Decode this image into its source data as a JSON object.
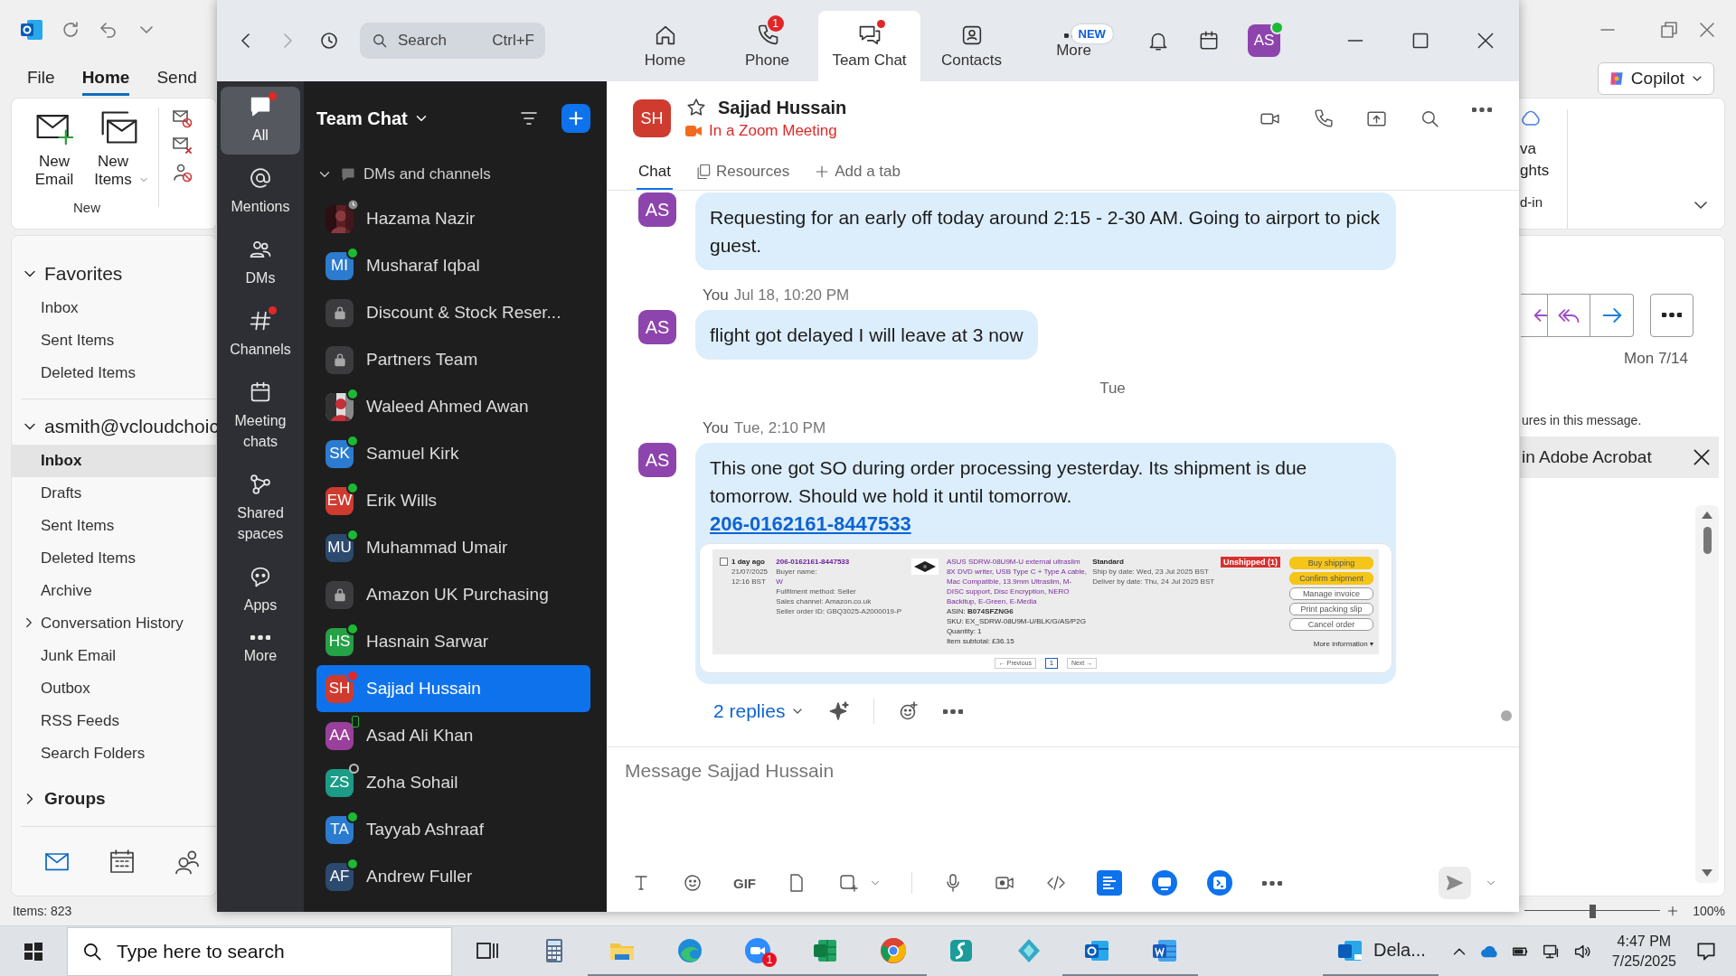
{
  "outlook": {
    "ribbon_tabs": [
      {
        "label": "File",
        "selected": false
      },
      {
        "label": "Home",
        "selected": true
      },
      {
        "label": "Send",
        "selected": false
      }
    ],
    "copilot": "Copilot",
    "ribbon": {
      "buttons": [
        {
          "label": "New Email",
          "dropdown": false
        },
        {
          "label": "New Items",
          "dropdown": true
        }
      ],
      "group_label": "New",
      "right_label": "va\nghts",
      "right_group_label": "d-in"
    },
    "favorites": {
      "label": "Favorites",
      "expanded": true,
      "folders": [
        {
          "label": "Inbox",
          "selected": false,
          "has_children": false
        },
        {
          "label": "Sent Items",
          "selected": false,
          "has_children": false
        },
        {
          "label": "Deleted Items",
          "selected": false,
          "has_children": false
        }
      ]
    },
    "account": {
      "label": "asmith@vcloudchoic",
      "expanded": true,
      "folders": [
        {
          "label": "Inbox",
          "selected": true,
          "has_children": false
        },
        {
          "label": "Drafts",
          "selected": false,
          "has_children": false
        },
        {
          "label": "Sent Items",
          "selected": false,
          "has_children": false
        },
        {
          "label": "Deleted Items",
          "selected": false,
          "has_children": false
        },
        {
          "label": "Archive",
          "selected": false,
          "has_children": false
        },
        {
          "label": "Conversation History",
          "selected": false,
          "has_children": true
        },
        {
          "label": "Junk Email",
          "selected": false,
          "has_children": false
        },
        {
          "label": "Outbox",
          "selected": false,
          "has_children": false
        },
        {
          "label": "RSS Feeds",
          "selected": false,
          "has_children": false
        },
        {
          "label": "Search Folders",
          "selected": false,
          "has_children": false
        }
      ]
    },
    "groups": {
      "label": "Groups",
      "expanded": false
    },
    "reading_pane": {
      "date": "Mon 7/14",
      "notice": "ures in this message.",
      "banner": "in Adobe Acrobat"
    },
    "status_bar": {
      "items": "Items: 823",
      "zoom": "100%",
      "zoom_slider": {
        "level": 0.5
      }
    }
  },
  "zoom": {
    "search": {
      "placeholder": "Search",
      "shortcut": "Ctrl+F"
    },
    "tabs": [
      {
        "label": "Home",
        "selected": false
      },
      {
        "label": "Phone",
        "selected": false,
        "badge": "1"
      },
      {
        "label": "Team Chat",
        "selected": true,
        "dot": true
      },
      {
        "label": "Contacts",
        "selected": false
      },
      {
        "label": "More",
        "selected": false,
        "tag": "NEW"
      }
    ],
    "profile": {
      "initials": "AS",
      "color": "#8e44ad",
      "online": true
    },
    "nav": [
      {
        "label": "All",
        "selected": true,
        "dot": true
      },
      {
        "label": "Mentions",
        "selected": false,
        "dot": false
      },
      {
        "label": "DMs",
        "selected": false,
        "dot": false
      },
      {
        "label": "Channels",
        "selected": false,
        "dot": true
      },
      {
        "label": "Meeting chats",
        "selected": false,
        "dot": false
      },
      {
        "label": "Shared spaces",
        "selected": false,
        "dot": false
      },
      {
        "label": "Apps",
        "selected": false,
        "dot": false
      },
      {
        "label": "More",
        "selected": false,
        "dot": false
      }
    ],
    "chat_list": {
      "title": "Team Chat",
      "section": {
        "label": "DMs and channels",
        "expanded": true
      },
      "items": [
        {
          "name": "Hazama Nazir",
          "status": {
            "kind": "clock"
          },
          "selected": false
        },
        {
          "name": "Musharaf Iqbal",
          "avatar": {
            "kind": "initials",
            "initials": "MI",
            "color": "#2b7bd0"
          },
          "status": {
            "kind": "available"
          },
          "selected": false
        },
        {
          "name": "Discount & Stock Reser...",
          "avatar": {
            "kind": "lock"
          },
          "selected": false
        },
        {
          "name": "Partners Team",
          "avatar": {
            "kind": "lock"
          },
          "selected": false
        },
        {
          "name": "Waleed Ahmed Awan",
          "status": {
            "kind": "available"
          },
          "selected": false
        },
        {
          "name": "Samuel Kirk",
          "avatar": {
            "kind": "initials",
            "initials": "SK",
            "color": "#2b7bd0"
          },
          "status": {
            "kind": "available"
          },
          "selected": false
        },
        {
          "name": "Erik Wills",
          "avatar": {
            "kind": "initials",
            "initials": "EW",
            "color": "#cf3b2f"
          },
          "status": {
            "kind": "available"
          },
          "selected": false
        },
        {
          "name": "Muhammad Umair",
          "avatar": {
            "kind": "initials",
            "initials": "MU",
            "color": "#2c4a6e"
          },
          "status": {
            "kind": "available"
          },
          "selected": false
        },
        {
          "name": "Amazon UK Purchasing",
          "avatar": {
            "kind": "lock"
          },
          "selected": false
        },
        {
          "name": "Hasnain Sarwar",
          "avatar": {
            "kind": "initials",
            "initials": "HS",
            "color": "#25a146"
          },
          "status": {
            "kind": "available"
          },
          "selected": false
        },
        {
          "name": "Sajjad Hussain",
          "avatar": {
            "kind": "initials",
            "initials": "SH",
            "color": "#cf3b2f"
          },
          "status": {
            "kind": "busy"
          },
          "selected": true
        },
        {
          "name": "Asad Ali Khan",
          "avatar": {
            "kind": "initials",
            "initials": "AA",
            "color": "#9a3f9b"
          },
          "status": {
            "kind": "mobile"
          },
          "selected": false
        },
        {
          "name": "Zoha Sohail",
          "avatar": {
            "kind": "initials",
            "initials": "ZS",
            "color": "#1c9b86"
          },
          "status": {
            "kind": "offline"
          },
          "selected": false
        },
        {
          "name": "Tayyab Ashraaf",
          "avatar": {
            "kind": "initials",
            "initials": "TA",
            "color": "#2b7bd0"
          },
          "status": {
            "kind": "available"
          },
          "selected": false
        },
        {
          "name": "Andrew Fuller",
          "avatar": {
            "kind": "initials",
            "initials": "AF",
            "color": "#2c4a6e"
          },
          "status": {
            "kind": "available"
          },
          "selected": false
        }
      ]
    },
    "conversation": {
      "name": "Sajjad Hussain",
      "avatar": {
        "initials": "SH",
        "color": "#cf3b2f"
      },
      "starred": false,
      "presence": "In a Zoom Meeting",
      "tabs": [
        {
          "label": "Chat",
          "selected": true
        },
        {
          "label": "Resources",
          "selected": false
        },
        {
          "label": "Add a tab",
          "selected": false
        }
      ],
      "messages": [
        {
          "kind": "message",
          "avatar": {
            "initials": "AS",
            "color": "#8e44ad"
          },
          "text": "Requesting for an early off today around 2:15 - 2-30 AM. Going to airport to pick guest."
        },
        {
          "kind": "message",
          "avatar": {
            "initials": "AS",
            "color": "#8e44ad"
          },
          "sender": "You",
          "time": "Jul 18, 10:20 PM",
          "text": "flight got delayed I will leave at 3 now"
        },
        {
          "kind": "date",
          "label": "Tue"
        },
        {
          "kind": "message",
          "avatar": {
            "initials": "AS",
            "color": "#8e44ad"
          },
          "sender": "You",
          "time": "Tue, 2:10 PM",
          "text": "This one got SO during order processing yesterday. Its shipment is due tomorrow. Should we hold it until tomorrow.",
          "link": "206-0162161-8447533",
          "attachment": {
            "kind": "screenshot",
            "checked": false,
            "date": [
              "1 day ago",
              "21/07/2025",
              "12:16 BST"
            ],
            "order_id": "206-0162161-8447533",
            "buyer_label": "Buyer name:",
            "buyer": "W",
            "order_details": [
              "Fulfilment method: Seller",
              "Sales channel: Amazon.co.uk",
              "Seller order ID: GBQ3025-A2000019-P"
            ],
            "product": "ASUS SDRW-08U9M-U external ultraslim 8X DVD writer, USB Type C + Type A cable, Mac Compatible, 13.9mm Ultraslim, M-DISC support, Disc Encryption, NERO Backitup, E-Green, E-Media",
            "product_details": [
              "ASIN: **B074SFZNG6**",
              "SKU: EX_SDRW-08U9M-U/BLK/G/AS/P2G",
              "Quantity: 1",
              "Item subtotal: £36.15"
            ],
            "order_type": "Standard",
            "dates": [
              "Ship by date: Wed, 23 Jul 2025 BST",
              "Deliver by date: Thu, 24 Jul 2025 BST"
            ],
            "status": "Unshipped (1)",
            "actions": [
              {
                "label": "Buy shipping",
                "primary": true
              },
              {
                "label": "Confirm shipment",
                "primary": true
              },
              {
                "label": "Manage invoice",
                "primary": false
              },
              {
                "label": "Print packing slip",
                "primary": false
              },
              {
                "label": "Cancel order",
                "primary": false
              }
            ],
            "more": "More information ▾",
            "pager": {
              "previous": "← Previous",
              "page": "1",
              "next": "Next →"
            }
          }
        }
      ],
      "replies": "2 replies"
    },
    "composer": {
      "placeholder": "Message Sajjad Hussain",
      "gif": "GIF"
    }
  },
  "taskbar": {
    "search_placeholder": "Type here to search",
    "apps": [
      {
        "running": false
      },
      {
        "running": false
      },
      {
        "running": true
      },
      {
        "running": true
      },
      {
        "running": true,
        "badge": "1"
      },
      {
        "running": true
      },
      {
        "running": true
      },
      {
        "running": false
      },
      {
        "running": false
      },
      {
        "running": true
      },
      {
        "running": true
      }
    ],
    "tray_app": "Dela...",
    "time": "4:47 PM",
    "date": "7/25/2025"
  }
}
